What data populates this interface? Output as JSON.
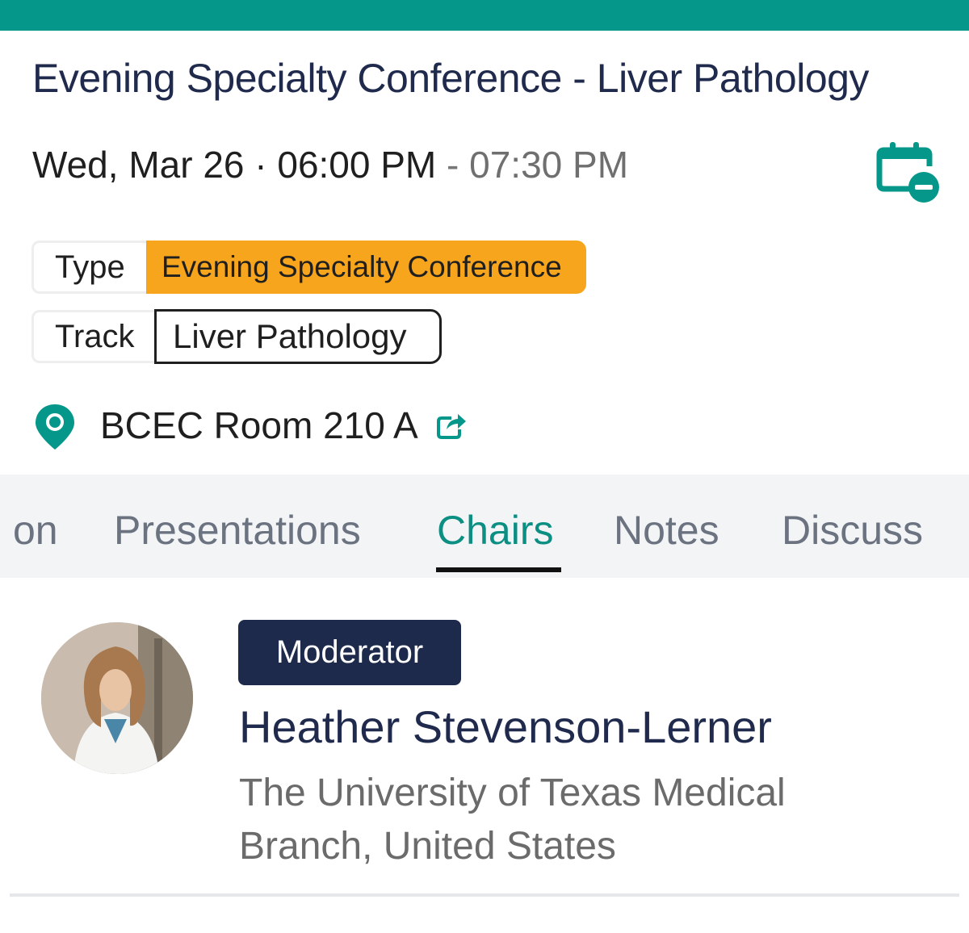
{
  "header": {
    "title": "Evening Specialty Conference - Liver Pathology"
  },
  "datetime": {
    "start": "Wed, Mar 26 · 06:00 PM",
    "separator": " - ",
    "end": "07:30 PM"
  },
  "meta": {
    "type_label": "Type",
    "type_value": "Evening Specialty Conference",
    "track_label": "Track",
    "track_value": "Liver Pathology"
  },
  "location": {
    "name": "BCEC Room 210 A"
  },
  "tabs": [
    {
      "label": "on"
    },
    {
      "label": "Presentations"
    },
    {
      "label": "Chairs"
    },
    {
      "label": "Notes"
    },
    {
      "label": "Discuss"
    }
  ],
  "active_tab": "Chairs",
  "chair": {
    "role": "Moderator",
    "name": "Heather Stevenson-Lerner",
    "affiliation_line1": "The University of Texas Medical",
    "affiliation_line2": "Branch, United States"
  },
  "colors": {
    "brand": "#05988a",
    "title": "#1f2a4d",
    "type_badge": "#f7a51d",
    "role_badge": "#1e2a4c",
    "active_tab": "#0b8f83"
  },
  "icons": {
    "calendar": "calendar-remove-icon",
    "location": "map-pin-icon",
    "external": "external-link-icon"
  }
}
